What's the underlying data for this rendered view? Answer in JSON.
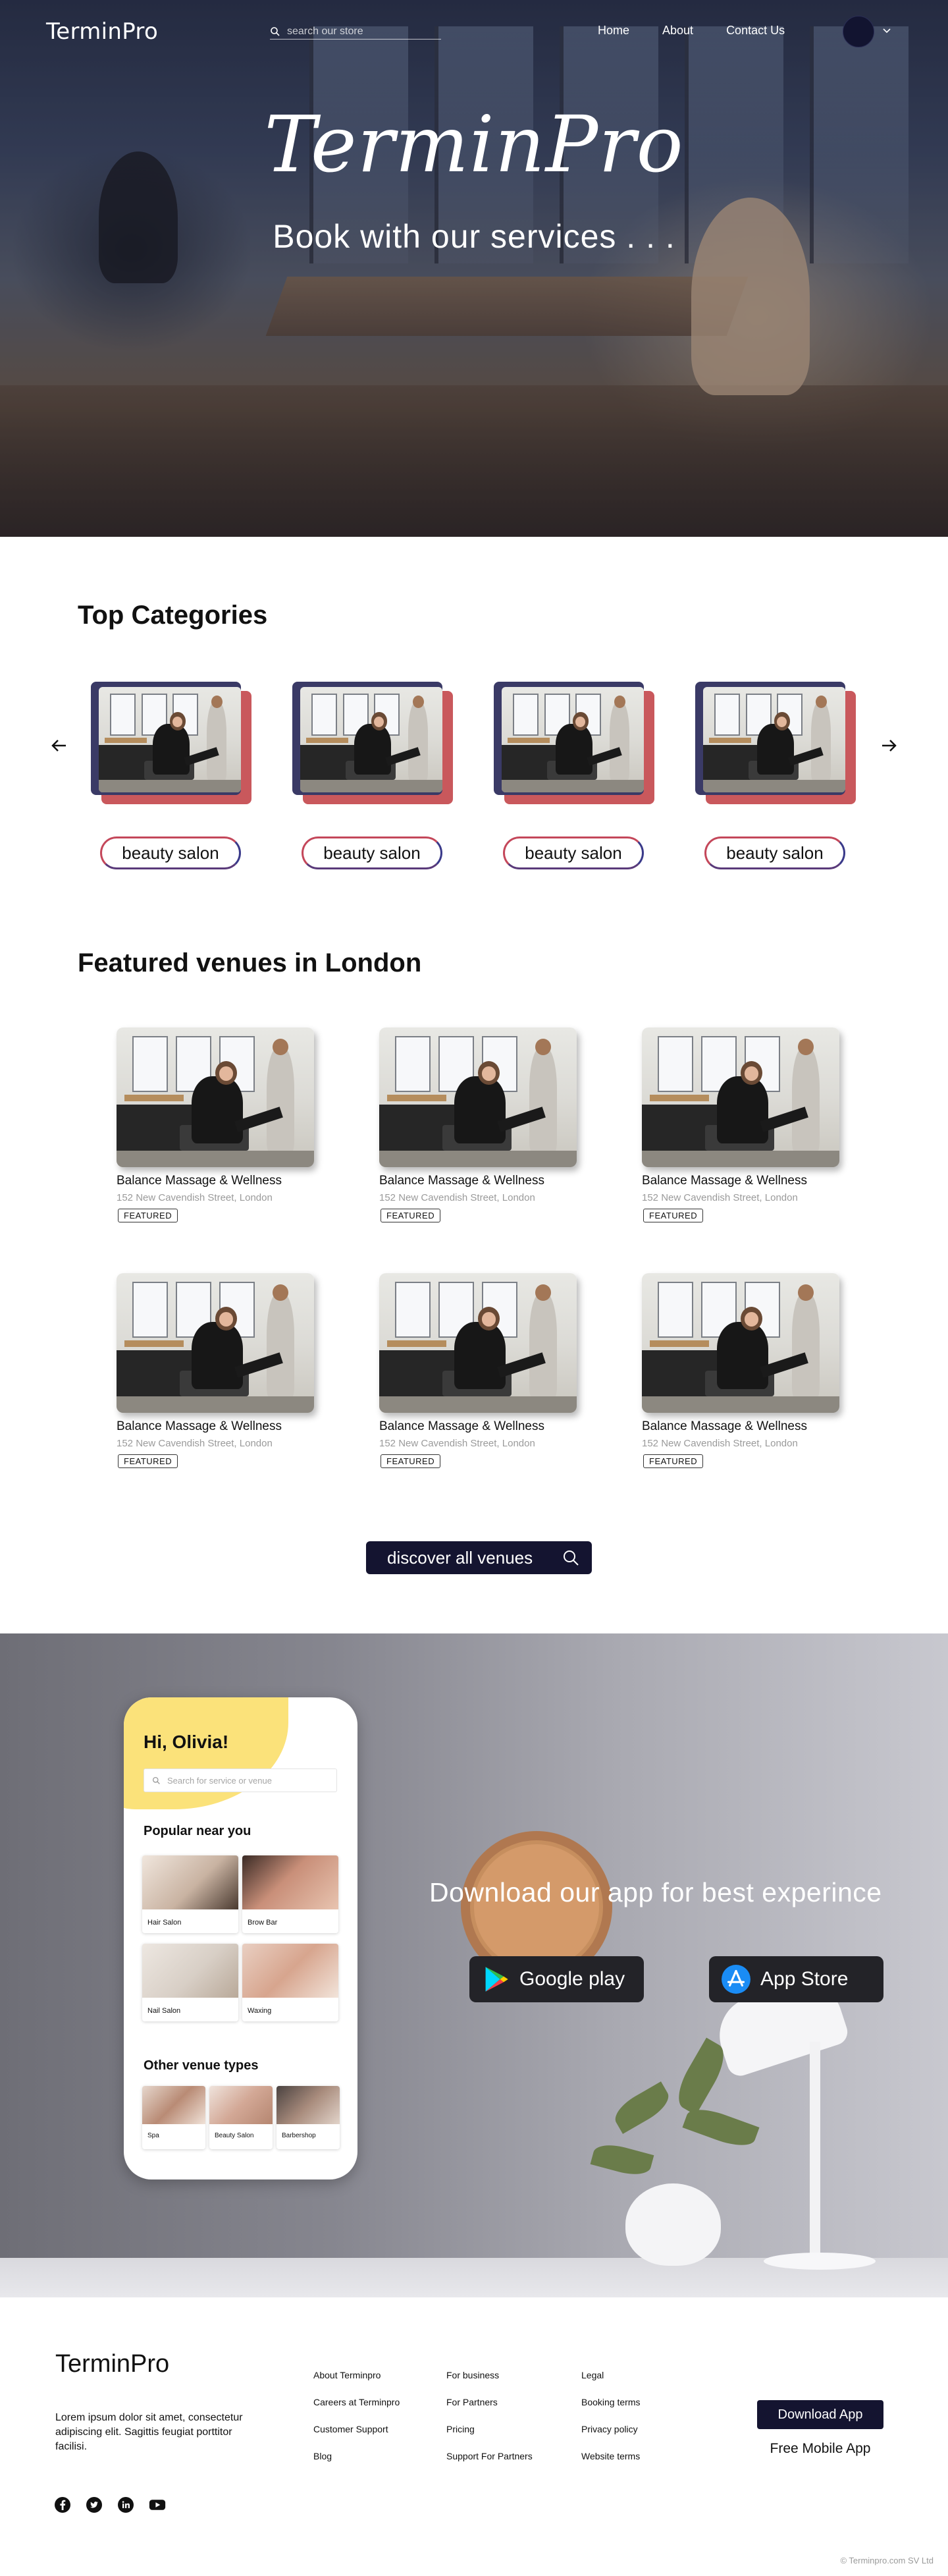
{
  "header": {
    "brand": "TerminPro",
    "search_placeholder": "search our store",
    "nav": [
      "Home",
      "About",
      "Contact Us"
    ]
  },
  "hero": {
    "title": "TerminPro",
    "subtitle": "Book with our services . . ."
  },
  "categories": {
    "title": "Top Categories",
    "items": [
      "beauty salon",
      "beauty salon",
      "beauty salon",
      "beauty salon"
    ]
  },
  "venues": {
    "title": "Featured venues in London",
    "items": [
      {
        "name": "Balance Massage & Wellness",
        "address": "152 New Cavendish Street, London",
        "badge": "FEATURED"
      },
      {
        "name": "Balance Massage & Wellness",
        "address": "152 New Cavendish Street, London",
        "badge": "FEATURED"
      },
      {
        "name": "Balance Massage & Wellness",
        "address": "152 New Cavendish Street, London",
        "badge": "FEATURED"
      },
      {
        "name": "Balance Massage & Wellness",
        "address": "152 New Cavendish Street, London",
        "badge": "FEATURED"
      },
      {
        "name": "Balance Massage & Wellness",
        "address": "152 New Cavendish Street, London",
        "badge": "FEATURED"
      },
      {
        "name": "Balance Massage & Wellness",
        "address": "152 New Cavendish Street, London",
        "badge": "FEATURED"
      }
    ],
    "discover_label": "discover all venues"
  },
  "app": {
    "phone": {
      "greeting": "Hi, Olivia!",
      "search_placeholder": "Search for service or venue",
      "popular_title": "Popular near you",
      "popular": [
        "Hair Salon",
        "Brow Bar",
        "Nail Salon",
        "Waxing"
      ],
      "other_title": "Other venue types",
      "other": [
        "Spa",
        "Beauty Salon",
        "Barbershop"
      ]
    },
    "title": "Download our app for best experince",
    "google_play": "Google play",
    "app_store": "App Store"
  },
  "footer": {
    "brand": "TerminPro",
    "description": "Lorem ipsum dolor sit amet, consectetur adipiscing elit. Sagittis feugiat porttitor facilisi.",
    "col1": [
      "About Terminpro",
      "Careers at Terminpro",
      "Customer Support",
      "Blog"
    ],
    "col2": [
      "For business",
      "For Partners",
      "Pricing",
      "Support For Partners"
    ],
    "col3": [
      "Legal",
      "Booking terms",
      "Privacy policy",
      "Website terms"
    ],
    "download_button": "Download App",
    "free_app": "Free Mobile App",
    "copyright": "© Terminpro.com SV Ltd",
    "socials": [
      "facebook-icon",
      "twitter-icon",
      "linkedin-icon",
      "youtube-icon"
    ]
  },
  "colors": {
    "navy": "#141430",
    "accent_red": "#c9585c",
    "accent_blue": "#3a3a66",
    "phone_yellow": "#fbe27a"
  }
}
